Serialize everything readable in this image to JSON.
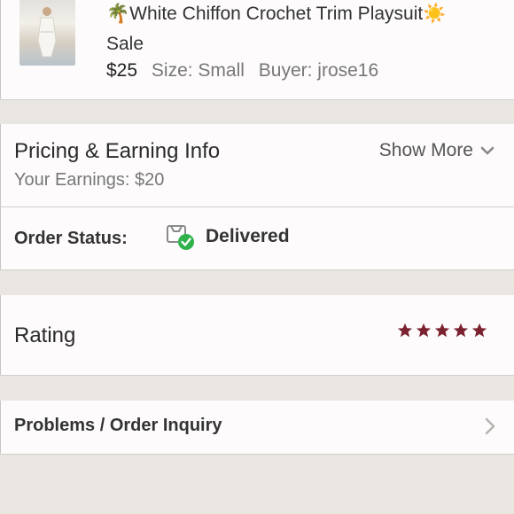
{
  "item": {
    "title_prefix_emoji": "🌴",
    "title": "White Chiffon Crochet Trim Playsuit",
    "title_suffix_emoji": "☀️",
    "status": "Sale",
    "price": "$25",
    "size": "Size: Small",
    "buyer": "Buyer: jrose16"
  },
  "pricing": {
    "heading": "Pricing & Earning Info",
    "earnings": "Your Earnings: $20",
    "show_more": "Show More"
  },
  "order_status": {
    "label": "Order Status:",
    "value": "Delivered",
    "icon": "delivered-box-icon"
  },
  "rating": {
    "label": "Rating",
    "stars": 5,
    "star_color": "#7b2231"
  },
  "problems": {
    "label": "Problems / Order Inquiry"
  },
  "colors": {
    "background": "#e9e6e1",
    "card": "#fdfbfb",
    "success": "#2fb24c"
  }
}
